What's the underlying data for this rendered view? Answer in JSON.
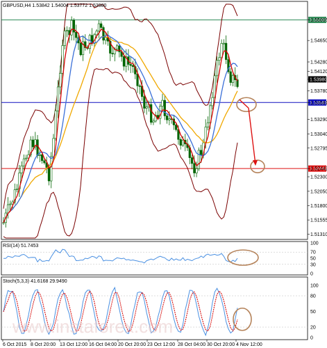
{
  "header": {
    "symbol_line": "GBPUSD,H4  1.53842 1.54004 1.53772 1.53980"
  },
  "price_axis": {
    "ticks": [
      "1.55005",
      "1.54650",
      "1.54280",
      "1.54120",
      "1.53980",
      "1.53780",
      "1.53581",
      "1.53290",
      "1.53040",
      "1.52795",
      "1.52442",
      "1.52300",
      "1.52050",
      "1.51800",
      "1.51555",
      "1.51310"
    ],
    "current_price": "1.53980",
    "levels": [
      {
        "name": "resistance",
        "price": "1.55005",
        "color": "#2e8b57"
      },
      {
        "name": "support",
        "price": "1.53581",
        "color": "#1010c0"
      },
      {
        "name": "target",
        "price": "1.52442",
        "color": "#dd1111"
      }
    ]
  },
  "rsi": {
    "label": "RSI(14) 51.7453",
    "ticks": [
      "100",
      "70",
      "50",
      "30",
      "0"
    ]
  },
  "stoch": {
    "label": "Stoch(5,3,3) 41.6168 29.9490",
    "ticks": [
      "100",
      "80",
      "50",
      "20",
      "0"
    ]
  },
  "time_axis": {
    "labels": [
      "6 Oct 2015",
      "8 Oct 20:00",
      "13 Oct 12:00",
      "16 Oct 04:00",
      "20 Oct 20:00",
      "23 Oct 12:00",
      "28 Oct 04:00",
      "30 Oct 20:00",
      "4 Nov 12:00"
    ]
  },
  "watermark": "www.instaforex.com",
  "colors": {
    "bollinger": "#7a0000",
    "ma_fast": "#d40000",
    "ma_mid": "#3a6fd8",
    "ma_slow": "#f0a800",
    "rsi_line": "#4a90e2",
    "annotation": "#b5835a"
  }
}
